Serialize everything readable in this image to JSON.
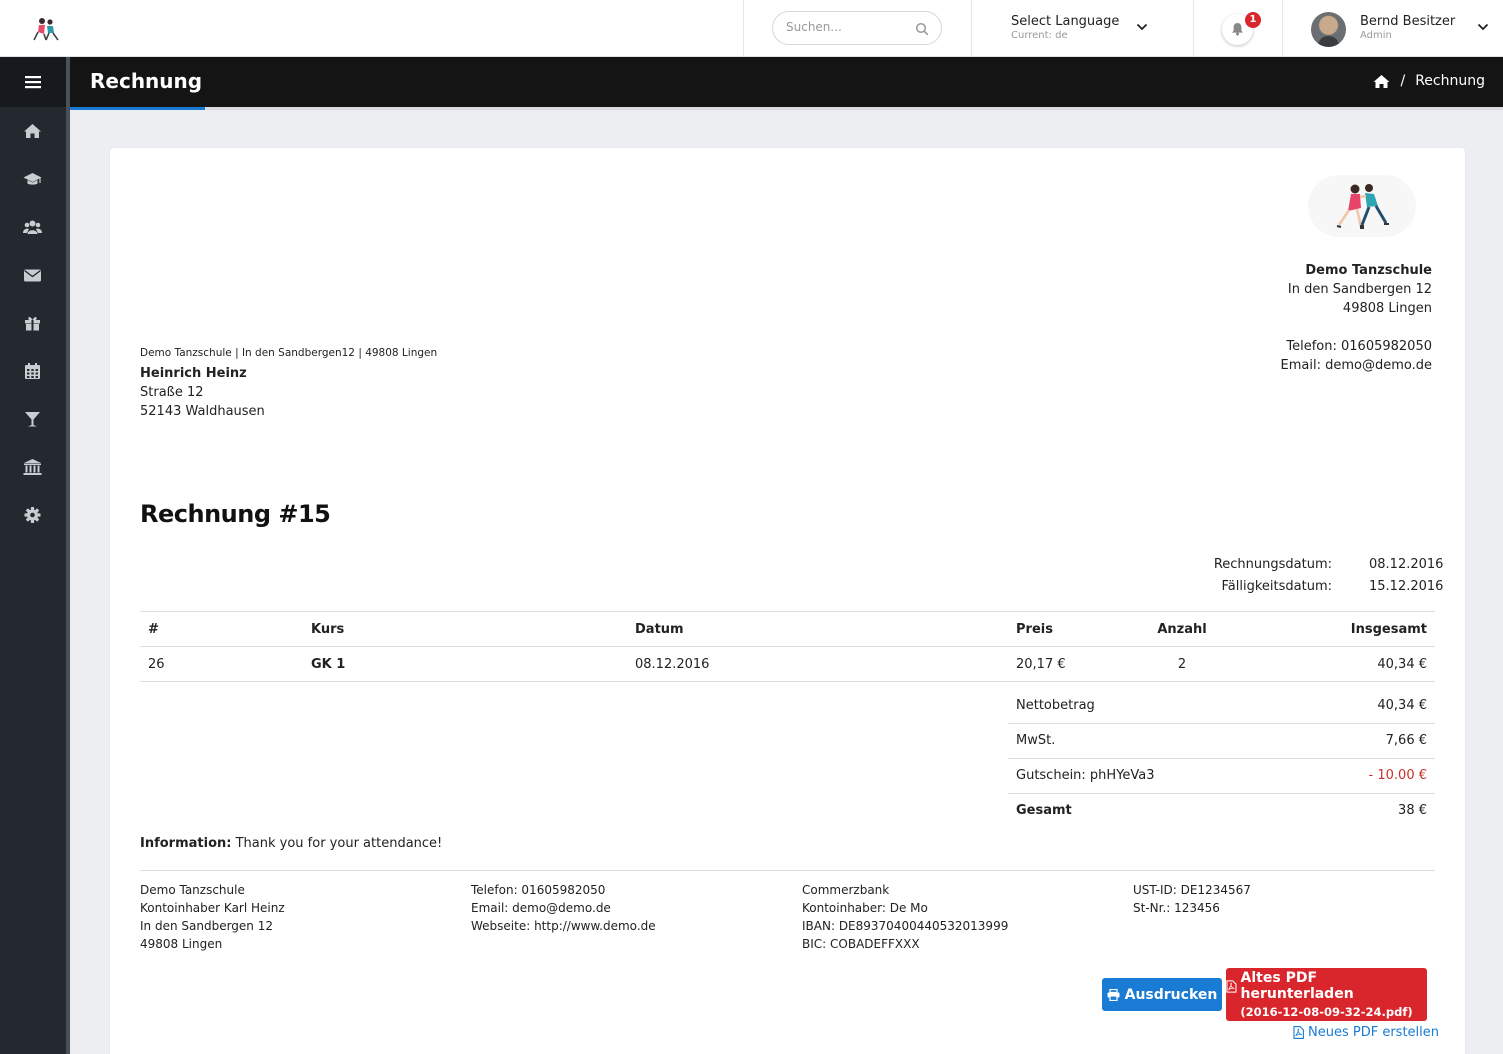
{
  "header": {
    "search_placeholder": "Suchen...",
    "language": {
      "label": "Select Language",
      "current": "Current: de"
    },
    "notifications": {
      "count": "1"
    },
    "user": {
      "name": "Bernd Besitzer",
      "role": "Admin"
    }
  },
  "page": {
    "title": "Rechnung",
    "breadcrumb": {
      "current": "Rechnung",
      "separator": "/"
    }
  },
  "colors": {
    "accent": "#1a7bd4",
    "danger": "#d9262c",
    "sidebar": "#24292f"
  },
  "sidebar_icons": [
    "home-icon",
    "graduation-cap-icon",
    "users-icon",
    "envelope-icon",
    "gift-icon",
    "calendar-icon",
    "cocktail-icon",
    "bank-icon",
    "gear-icon"
  ],
  "invoice": {
    "company": {
      "name": "Demo Tanzschule",
      "street": "In den Sandbergen 12",
      "city": "49808 Lingen",
      "phone": "Telefon: 01605982050",
      "email": "Email: demo@demo.de"
    },
    "sender_line": "Demo Tanzschule | In den Sandbergen12 | 49808 Lingen",
    "recipient": {
      "name": "Heinrich Heinz",
      "street": "Straße 12",
      "city": "52143 Waldhausen"
    },
    "title": "Rechnung #15",
    "dates": [
      {
        "label": "Rechnungsdatum:",
        "value": "08.12.2016"
      },
      {
        "label": "Fälligkeitsdatum:",
        "value": "15.12.2016"
      }
    ],
    "columns": [
      "#",
      "Kurs",
      "Datum",
      "Preis",
      "Anzahl",
      "Insgesamt"
    ],
    "rows": [
      {
        "num": "26",
        "course": "GK 1",
        "date": "08.12.2016",
        "price": "20,17 €",
        "qty": "2",
        "total": "40,34 €"
      }
    ],
    "totals": [
      {
        "label": "Nettobetrag",
        "value": "40,34 €"
      },
      {
        "label": "MwSt.",
        "value": "7,66 €"
      },
      {
        "label": "Gutschein: phHYeVa3",
        "value": "- 10.00 €"
      },
      {
        "label": "Gesamt",
        "value": "38 €"
      }
    ],
    "information": {
      "label": "Information:",
      "text": "Thank you for your attendance!"
    },
    "footer": {
      "col1": [
        "Demo Tanzschule",
        "Kontoinhaber Karl Heinz",
        "In den Sandbergen 12",
        "49808 Lingen"
      ],
      "col2": [
        "Telefon: 01605982050",
        "Email: demo@demo.de",
        "Webseite: http://www.demo.de"
      ],
      "col3": [
        "Commerzbank",
        "Kontoinhaber: De Mo",
        "IBAN: DE89370400440532013999",
        "BIC: COBADEFFXXX"
      ],
      "col4": [
        "UST-ID: DE1234567",
        "St-Nr.: 123456"
      ]
    },
    "actions": {
      "print": "Ausdrucken",
      "old_pdf": "Altes PDF herunterladen",
      "old_pdf_file": "(2016-12-08-09-32-24.pdf)",
      "new_pdf": "Neues PDF erstellen"
    }
  }
}
